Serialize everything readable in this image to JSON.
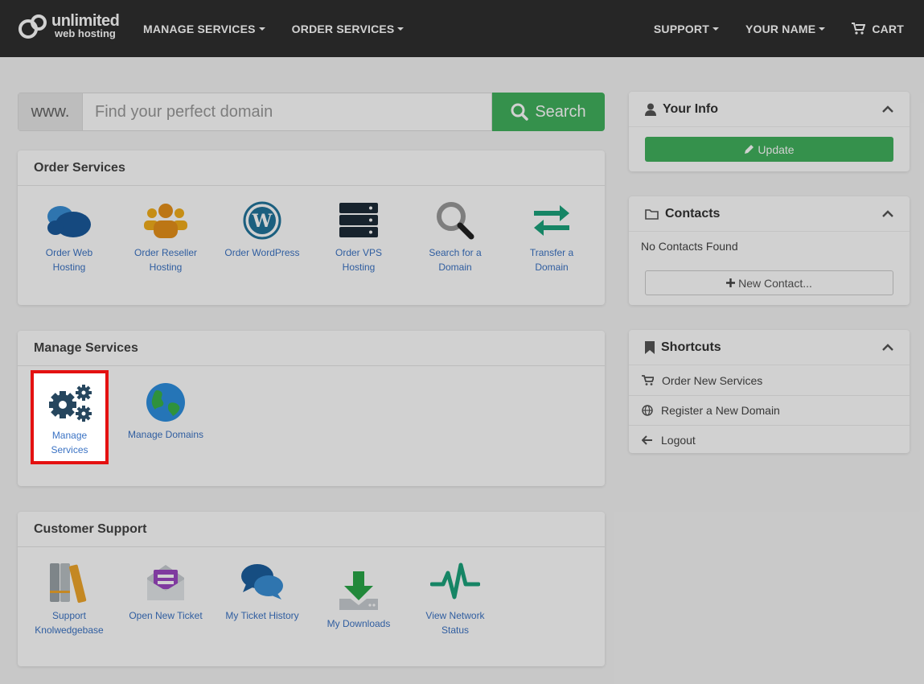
{
  "brand": {
    "line1": "unlimited",
    "line2": "web hosting"
  },
  "nav": {
    "manage_services": "MANAGE SERVICES",
    "order_services": "ORDER SERVICES",
    "support": "SUPPORT",
    "your_name": "YOUR NAME",
    "cart": "CART"
  },
  "search": {
    "prefix": "www.",
    "placeholder": "Find your perfect domain",
    "button": "Search"
  },
  "order_services": {
    "title": "Order Services",
    "tiles": [
      {
        "label": "Order Web Hosting"
      },
      {
        "label": "Order Reseller Hosting"
      },
      {
        "label": "Order WordPress"
      },
      {
        "label": "Order VPS Hosting"
      },
      {
        "label": "Search for a Domain"
      },
      {
        "label": "Transfer a Domain"
      }
    ]
  },
  "manage_services": {
    "title": "Manage Services",
    "tiles": [
      {
        "label": "Manage Services"
      },
      {
        "label": "Manage Domains"
      }
    ]
  },
  "customer_support": {
    "title": "Customer Support",
    "tiles": [
      {
        "label": "Support Knolwedgebase"
      },
      {
        "label": "Open New Ticket"
      },
      {
        "label": "My Ticket History"
      },
      {
        "label": "My Downloads"
      },
      {
        "label": "View Network Status"
      }
    ]
  },
  "your_info": {
    "title": "Your Info",
    "button": "Update"
  },
  "contacts": {
    "title": "Contacts",
    "empty": "No Contacts Found",
    "button": "New Contact..."
  },
  "shortcuts": {
    "title": "Shortcuts",
    "items": [
      {
        "label": "Order New Services",
        "icon": "cart-icon"
      },
      {
        "label": "Register a New Domain",
        "icon": "globe-icon"
      },
      {
        "label": "Logout",
        "icon": "arrow-left-icon"
      }
    ]
  },
  "colors": {
    "header": "#2f2f2f",
    "accent_green": "#41b15d",
    "link_blue": "#3b73c4",
    "highlight_red": "#e41111"
  }
}
